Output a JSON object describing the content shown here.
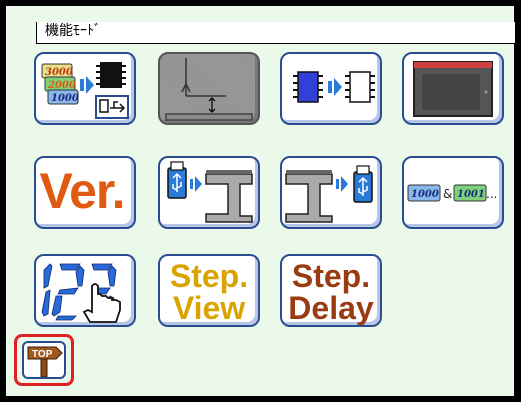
{
  "window": {
    "title": "機能ﾓｰﾄﾞ"
  },
  "buttons": {
    "ver_label": "Ver.",
    "step_view_line1": "Step.",
    "step_view_line2": "View",
    "step_delay_line1": "Step.",
    "step_delay_line2": "Delay",
    "counter_3000": "3000",
    "counter_2000": "2000",
    "counter_1000": "1000",
    "convert_1000": "1000",
    "convert_and": "&",
    "convert_1001": "1001",
    "convert_ellipsis": "...",
    "top_label": "TOP"
  },
  "colors": {
    "screen_bg": "#eaf9ea",
    "button_border": "#2a4d8f",
    "highlight": "#e02020",
    "ver_orange": "#e05a12",
    "step_gold": "#d9a400",
    "step_brown": "#9a3b12"
  }
}
